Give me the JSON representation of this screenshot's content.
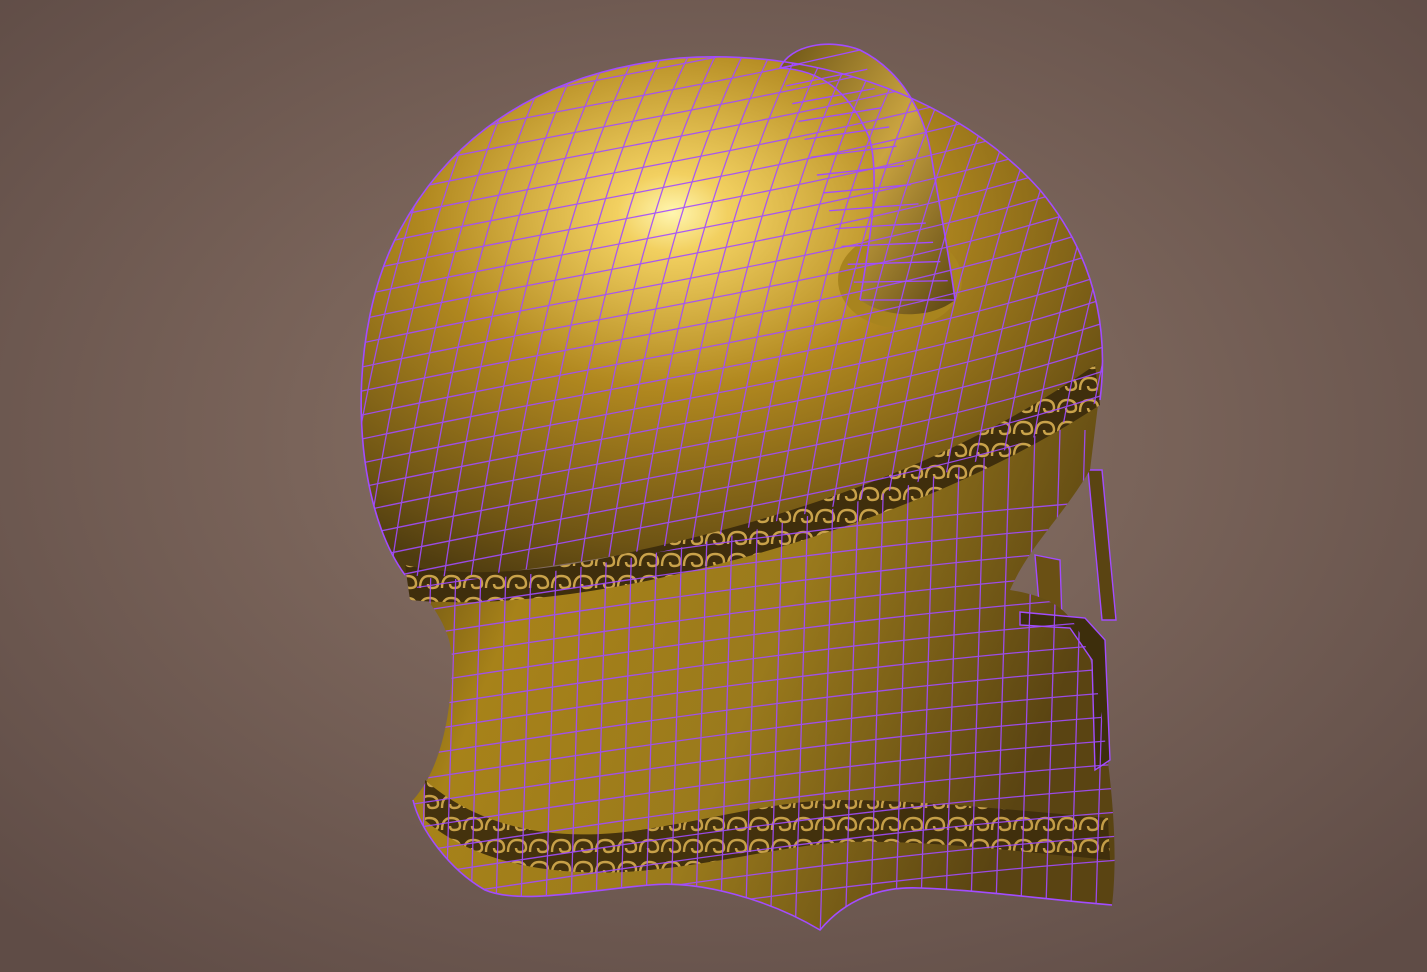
{
  "viewport": {
    "subject": "bronze-helmet-wireframe",
    "colors": {
      "background_center": "#8d7568",
      "background_edge": "#5f4c46",
      "wireframe": "#a24cff",
      "bronze_light": "#f2d060",
      "bronze_mid": "#b1881f",
      "bronze_dark": "#4f3c10",
      "band_dark": "#3f2e0c",
      "band_light": "#c9a24a"
    }
  }
}
